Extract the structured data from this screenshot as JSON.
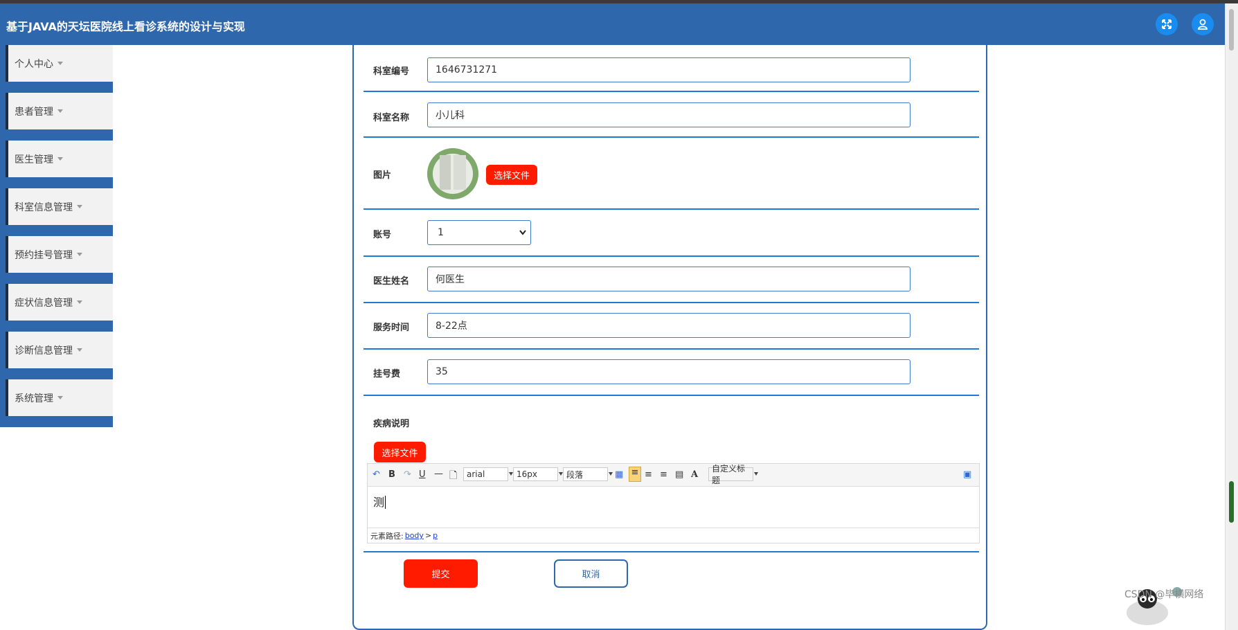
{
  "app": {
    "title": "基于JAVA的天坛医院线上看诊系统的设计与实现"
  },
  "header_icons": [
    "fullscreen-icon",
    "user-icon"
  ],
  "sidebar": {
    "items": [
      {
        "label": "个人中心"
      },
      {
        "label": "患者管理"
      },
      {
        "label": "医生管理"
      },
      {
        "label": "科室信息管理"
      },
      {
        "label": "预约挂号管理"
      },
      {
        "label": "症状信息管理"
      },
      {
        "label": "诊断信息管理"
      },
      {
        "label": "系统管理"
      }
    ]
  },
  "form": {
    "dept_id": {
      "label": "科室编号",
      "value": "1646731271"
    },
    "dept_name": {
      "label": "科室名称",
      "value": "小儿科"
    },
    "image": {
      "label": "图片",
      "upload_label": "选择文件"
    },
    "account": {
      "label": "账号",
      "value": "1"
    },
    "doctor_name": {
      "label": "医生姓名",
      "value": "何医生"
    },
    "service_time": {
      "label": "服务时间",
      "value": "8-22点"
    },
    "fee": {
      "label": "挂号费",
      "value": "35"
    },
    "disease": {
      "label": "疾病说明",
      "upload_label": "选择文件"
    }
  },
  "editor": {
    "font_family": "arial",
    "font_size": "16px",
    "paragraph": "段落",
    "custom_title": "自定义标题",
    "content": "测",
    "path_label": "元素路径:",
    "path_body": "body",
    "path_sep": ">",
    "path_p": "p"
  },
  "actions": {
    "submit": "提交",
    "cancel": "取消"
  },
  "watermark": "CSDN @毕横网络",
  "colors": {
    "header": "#2f67ad",
    "accent_red": "#ff1b00",
    "divider": "#1e78d6"
  }
}
